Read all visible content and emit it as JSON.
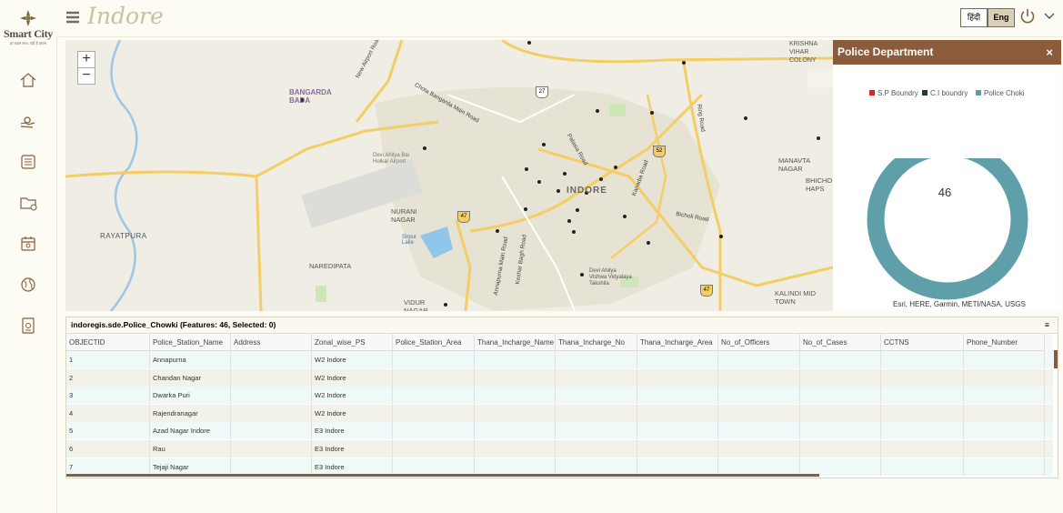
{
  "app": {
    "title": "Indore",
    "logo_name": "Smart City",
    "logo_sub": "INDORE",
    "logo_tagline": "हर कदम साथ, यही है प्रयास",
    "lang_hindi": "हिंदी",
    "lang_eng": "Eng"
  },
  "map": {
    "labels": [
      "BANGARDA BADA",
      "RAYATPURA",
      "NURANI NAGAR",
      "NAREDIPATA",
      "VIDUR NAGAR",
      "INDORE",
      "MANAVTA NAGAR",
      "BHICHO HAPS",
      "KALINDI MID TOWN",
      "KRISHNA VIHAR COLONY",
      "Devi Ahilya Bai Holkar Airport",
      "Sirpur Lake",
      "Devi Ahilya Vishwa Vidyalaya Takshila",
      "New Airport Road",
      "Chota Bangarda Main Road",
      "Ring Road",
      "Bicholi Road",
      "Annapurna Main Road",
      "Keshar Bagh Road",
      "Kanadia Road",
      "Palasia Road"
    ],
    "route_shields": [
      "27",
      "52",
      "47",
      "47"
    ],
    "zoom_in": "+",
    "zoom_out": "−"
  },
  "panel": {
    "title": "Police Department",
    "close": "×",
    "legend": [
      {
        "label": "S.P Boundry",
        "color": "#d9262c"
      },
      {
        "label": "C.I boundry",
        "color": "#1f3a44"
      },
      {
        "label": "Police Choki",
        "color": "#5f9faa"
      }
    ],
    "center_value": "46",
    "attribution": "Esri, HERE, Garmin, METI/NASA, USGS"
  },
  "table": {
    "title": "indoregis.sde.Police_Chowki (Features: 46, Selected: 0)",
    "menu_icon": "≡",
    "columns": [
      "OBJECTID",
      "Police_Station_Name",
      "Address",
      "Zonal_wise_PS",
      "Police_Station_Area",
      "Thana_Incharge_Name",
      "Thana_Incharge_No",
      "Thana_Incharge_Area",
      "No_of_Officers",
      "No_of_Cases",
      "CCTNS",
      "Phone_Number"
    ],
    "rows": [
      [
        "1",
        "Annapurna",
        "",
        "W2 Indore"
      ],
      [
        "2",
        "Chandan Nagar",
        "",
        "W2 Indore"
      ],
      [
        "3",
        "Dwarka Puri",
        "",
        "W2 Indore"
      ],
      [
        "4",
        "Rajendranagar",
        "",
        "W2 Indore"
      ],
      [
        "5",
        "Azad Nagar Indore",
        "",
        "E3 Indore"
      ],
      [
        "6",
        "Rau",
        "",
        "E3 Indore"
      ],
      [
        "7",
        "Tejaji Nagar",
        "",
        "E3 Indore"
      ]
    ]
  }
}
